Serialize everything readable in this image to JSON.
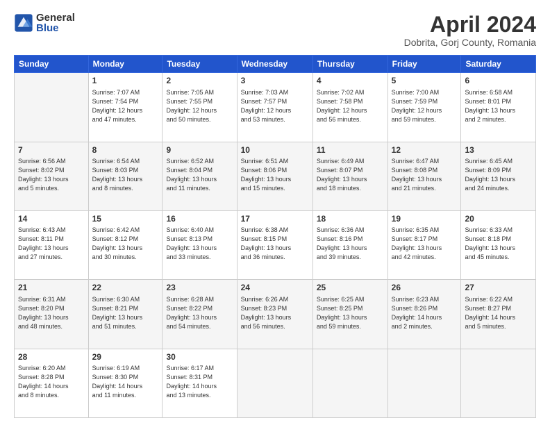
{
  "logo": {
    "general": "General",
    "blue": "Blue"
  },
  "title": "April 2024",
  "location": "Dobrita, Gorj County, Romania",
  "weekdays": [
    "Sunday",
    "Monday",
    "Tuesday",
    "Wednesday",
    "Thursday",
    "Friday",
    "Saturday"
  ],
  "weeks": [
    [
      {
        "day": "",
        "info": ""
      },
      {
        "day": "1",
        "info": "Sunrise: 7:07 AM\nSunset: 7:54 PM\nDaylight: 12 hours\nand 47 minutes."
      },
      {
        "day": "2",
        "info": "Sunrise: 7:05 AM\nSunset: 7:55 PM\nDaylight: 12 hours\nand 50 minutes."
      },
      {
        "day": "3",
        "info": "Sunrise: 7:03 AM\nSunset: 7:57 PM\nDaylight: 12 hours\nand 53 minutes."
      },
      {
        "day": "4",
        "info": "Sunrise: 7:02 AM\nSunset: 7:58 PM\nDaylight: 12 hours\nand 56 minutes."
      },
      {
        "day": "5",
        "info": "Sunrise: 7:00 AM\nSunset: 7:59 PM\nDaylight: 12 hours\nand 59 minutes."
      },
      {
        "day": "6",
        "info": "Sunrise: 6:58 AM\nSunset: 8:01 PM\nDaylight: 13 hours\nand 2 minutes."
      }
    ],
    [
      {
        "day": "7",
        "info": "Sunrise: 6:56 AM\nSunset: 8:02 PM\nDaylight: 13 hours\nand 5 minutes."
      },
      {
        "day": "8",
        "info": "Sunrise: 6:54 AM\nSunset: 8:03 PM\nDaylight: 13 hours\nand 8 minutes."
      },
      {
        "day": "9",
        "info": "Sunrise: 6:52 AM\nSunset: 8:04 PM\nDaylight: 13 hours\nand 11 minutes."
      },
      {
        "day": "10",
        "info": "Sunrise: 6:51 AM\nSunset: 8:06 PM\nDaylight: 13 hours\nand 15 minutes."
      },
      {
        "day": "11",
        "info": "Sunrise: 6:49 AM\nSunset: 8:07 PM\nDaylight: 13 hours\nand 18 minutes."
      },
      {
        "day": "12",
        "info": "Sunrise: 6:47 AM\nSunset: 8:08 PM\nDaylight: 13 hours\nand 21 minutes."
      },
      {
        "day": "13",
        "info": "Sunrise: 6:45 AM\nSunset: 8:09 PM\nDaylight: 13 hours\nand 24 minutes."
      }
    ],
    [
      {
        "day": "14",
        "info": "Sunrise: 6:43 AM\nSunset: 8:11 PM\nDaylight: 13 hours\nand 27 minutes."
      },
      {
        "day": "15",
        "info": "Sunrise: 6:42 AM\nSunset: 8:12 PM\nDaylight: 13 hours\nand 30 minutes."
      },
      {
        "day": "16",
        "info": "Sunrise: 6:40 AM\nSunset: 8:13 PM\nDaylight: 13 hours\nand 33 minutes."
      },
      {
        "day": "17",
        "info": "Sunrise: 6:38 AM\nSunset: 8:15 PM\nDaylight: 13 hours\nand 36 minutes."
      },
      {
        "day": "18",
        "info": "Sunrise: 6:36 AM\nSunset: 8:16 PM\nDaylight: 13 hours\nand 39 minutes."
      },
      {
        "day": "19",
        "info": "Sunrise: 6:35 AM\nSunset: 8:17 PM\nDaylight: 13 hours\nand 42 minutes."
      },
      {
        "day": "20",
        "info": "Sunrise: 6:33 AM\nSunset: 8:18 PM\nDaylight: 13 hours\nand 45 minutes."
      }
    ],
    [
      {
        "day": "21",
        "info": "Sunrise: 6:31 AM\nSunset: 8:20 PM\nDaylight: 13 hours\nand 48 minutes."
      },
      {
        "day": "22",
        "info": "Sunrise: 6:30 AM\nSunset: 8:21 PM\nDaylight: 13 hours\nand 51 minutes."
      },
      {
        "day": "23",
        "info": "Sunrise: 6:28 AM\nSunset: 8:22 PM\nDaylight: 13 hours\nand 54 minutes."
      },
      {
        "day": "24",
        "info": "Sunrise: 6:26 AM\nSunset: 8:23 PM\nDaylight: 13 hours\nand 56 minutes."
      },
      {
        "day": "25",
        "info": "Sunrise: 6:25 AM\nSunset: 8:25 PM\nDaylight: 13 hours\nand 59 minutes."
      },
      {
        "day": "26",
        "info": "Sunrise: 6:23 AM\nSunset: 8:26 PM\nDaylight: 14 hours\nand 2 minutes."
      },
      {
        "day": "27",
        "info": "Sunrise: 6:22 AM\nSunset: 8:27 PM\nDaylight: 14 hours\nand 5 minutes."
      }
    ],
    [
      {
        "day": "28",
        "info": "Sunrise: 6:20 AM\nSunset: 8:28 PM\nDaylight: 14 hours\nand 8 minutes."
      },
      {
        "day": "29",
        "info": "Sunrise: 6:19 AM\nSunset: 8:30 PM\nDaylight: 14 hours\nand 11 minutes."
      },
      {
        "day": "30",
        "info": "Sunrise: 6:17 AM\nSunset: 8:31 PM\nDaylight: 14 hours\nand 13 minutes."
      },
      {
        "day": "",
        "info": ""
      },
      {
        "day": "",
        "info": ""
      },
      {
        "day": "",
        "info": ""
      },
      {
        "day": "",
        "info": ""
      }
    ]
  ]
}
